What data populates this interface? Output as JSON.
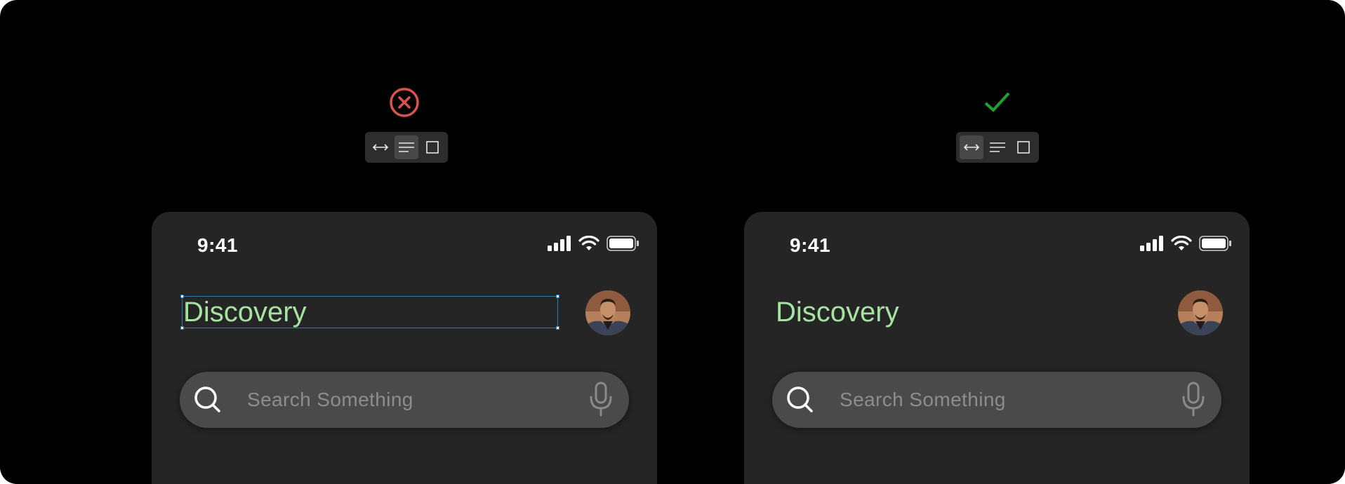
{
  "colors": {
    "background": "#000000",
    "phone_background": "#252525",
    "title_color": "#a6e3a1",
    "error_red": "#d9534f",
    "success_green": "#1fa131",
    "selection_blue": "#2a7ab5"
  },
  "examples": [
    {
      "status": "incorrect",
      "status_icon": "x-circle-icon",
      "toolbar": {
        "tools": [
          "hug-width-icon",
          "fixed-width-icon",
          "fixed-size-icon"
        ],
        "active_tool": "fixed-width-icon"
      },
      "phone": {
        "time": "9:41",
        "title": "Discovery",
        "title_selected": true,
        "search_placeholder": "Search Something"
      }
    },
    {
      "status": "correct",
      "status_icon": "checkmark-icon",
      "toolbar": {
        "tools": [
          "hug-width-icon",
          "fixed-width-icon",
          "fixed-size-icon"
        ],
        "active_tool": "hug-width-icon"
      },
      "phone": {
        "time": "9:41",
        "title": "Discovery",
        "title_selected": false,
        "search_placeholder": "Search Something"
      }
    }
  ]
}
